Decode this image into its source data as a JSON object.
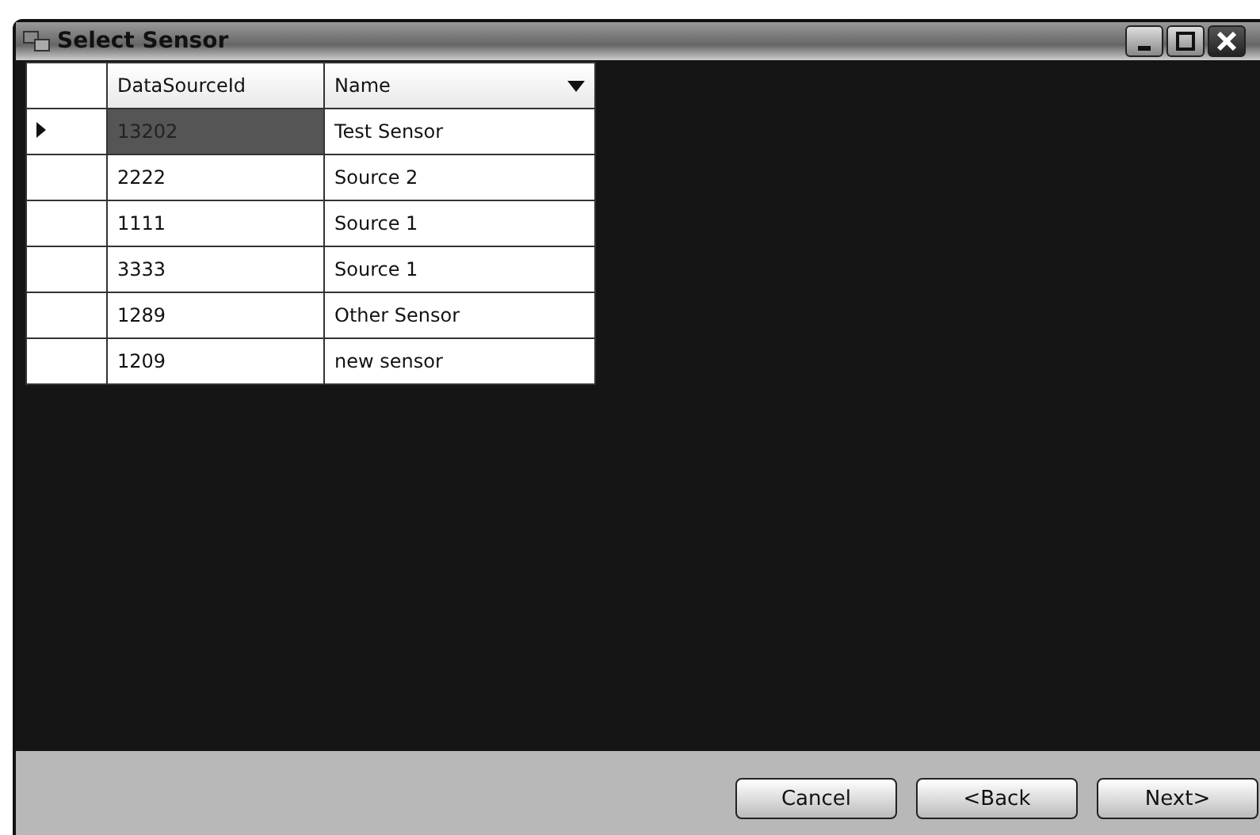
{
  "window": {
    "title": "Select Sensor"
  },
  "table": {
    "columns": [
      "DataSourceId",
      "Name"
    ],
    "rows": [
      {
        "cells": [
          "13202",
          "Test Sensor"
        ],
        "selected": true
      },
      {
        "cells": [
          "2222",
          "Source 2"
        ],
        "selected": false
      },
      {
        "cells": [
          "1111",
          "Source 1"
        ],
        "selected": false
      },
      {
        "cells": [
          "3333",
          "Source 1"
        ],
        "selected": false
      },
      {
        "cells": [
          "1289",
          "Other Sensor"
        ],
        "selected": false
      },
      {
        "cells": [
          "1209",
          "new sensor"
        ],
        "selected": false
      }
    ]
  },
  "buttons": [
    "Cancel",
    "<Back",
    "Next>"
  ]
}
